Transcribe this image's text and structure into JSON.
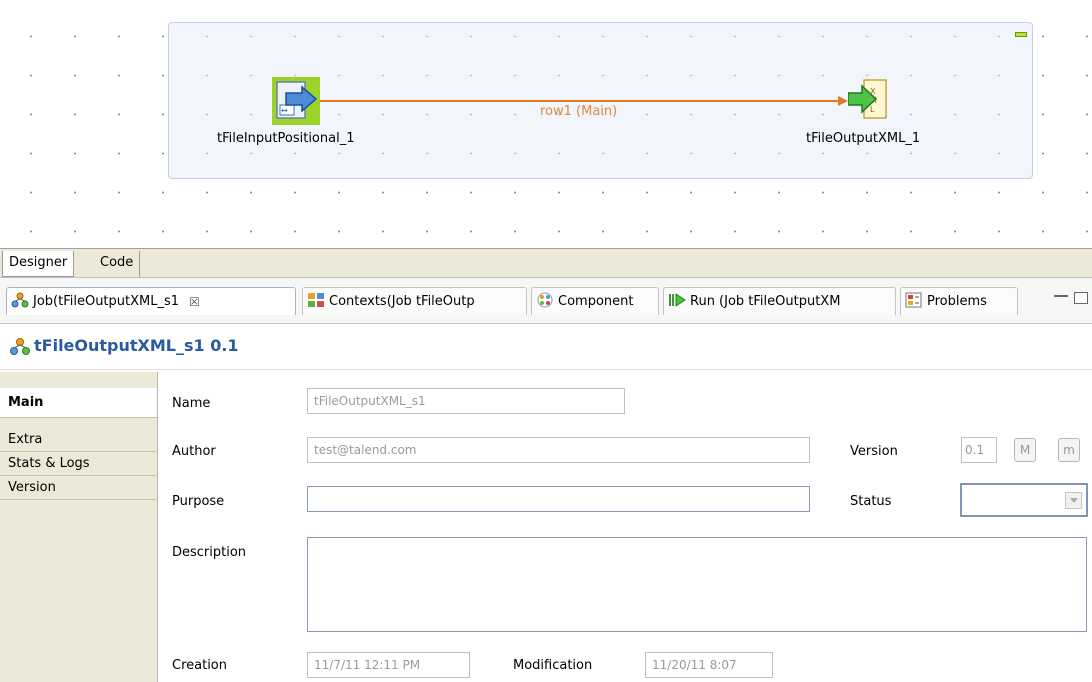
{
  "designer": {
    "components": {
      "input": {
        "label": "tFileInputPositional_1"
      },
      "output": {
        "label": "tFileOutputXML_1"
      }
    },
    "connection": {
      "label": "row1 (Main)",
      "color": "#e07a20"
    }
  },
  "editor_tabs": {
    "designer": "Designer",
    "code": "Code"
  },
  "view_tabs": {
    "job": "Job(tFileOutputXML_s1",
    "contexts": "Contexts(Job tFileOutp",
    "component": "Component",
    "run": "Run (Job tFileOutputXM",
    "problems": "Problems",
    "close_glyph": "☒"
  },
  "job_header": {
    "title": "tFileOutputXML_s1 0.1"
  },
  "side_tabs": [
    "Main",
    "Extra",
    "Stats & Logs",
    "Version"
  ],
  "form": {
    "name_label": "Name",
    "name_value": "tFileOutputXML_s1",
    "author_label": "Author",
    "author_value": "test@talend.com",
    "version_label": "Version",
    "version_value": "0.1",
    "major_btn": "M",
    "minor_btn": "m",
    "purpose_label": "Purpose",
    "purpose_value": "",
    "status_label": "Status",
    "status_value": "",
    "description_label": "Description",
    "description_value": "",
    "creation_label": "Creation",
    "creation_value": "11/7/11 12:11 PM",
    "modification_label": "Modification",
    "modification_value": "11/20/11 8:07"
  },
  "colors": {
    "accent": "#2a5aa0",
    "connection": "#e07a20"
  }
}
